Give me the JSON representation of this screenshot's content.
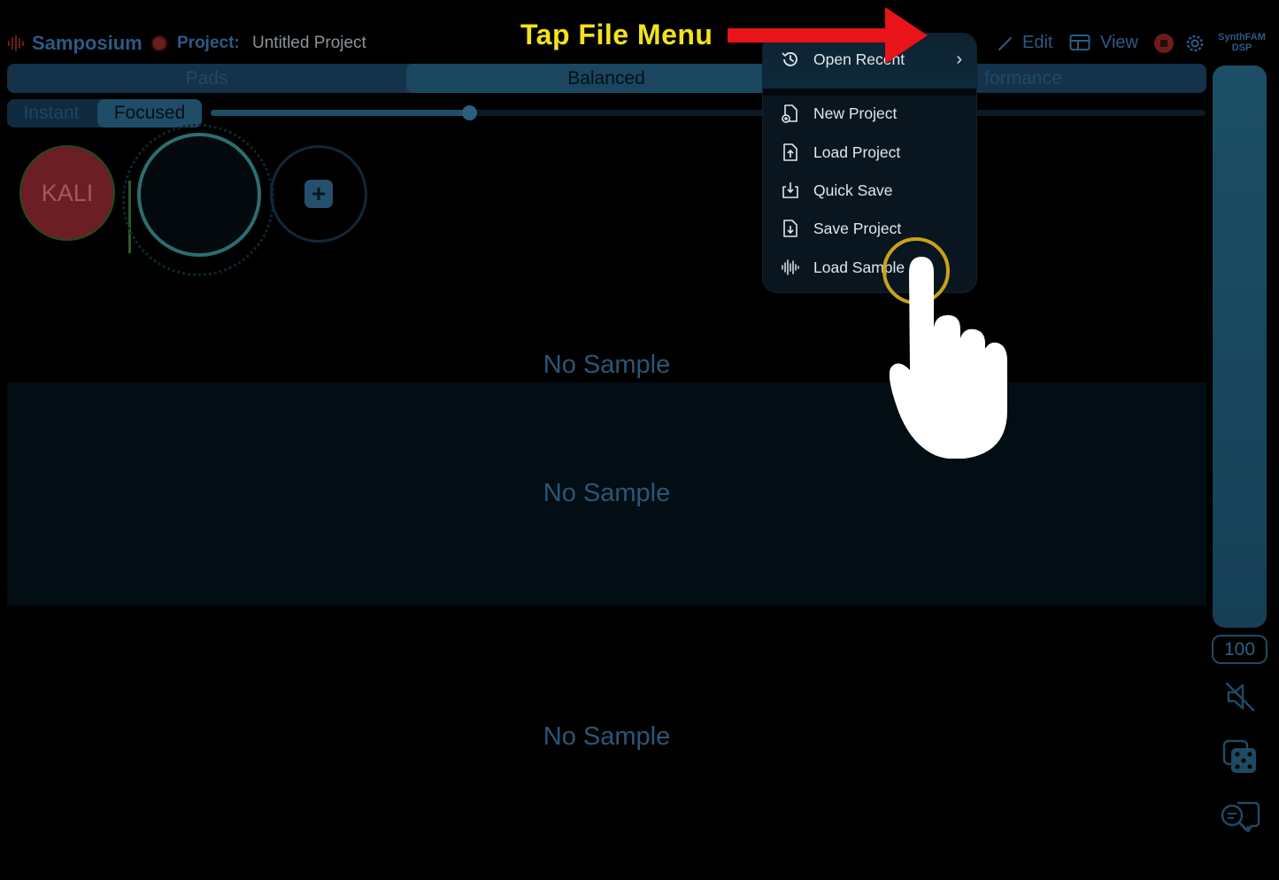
{
  "header": {
    "app_name": "Samposium",
    "project_label": "Project:",
    "project_name": "Untitled Project",
    "edit_label": "Edit",
    "view_label": "View",
    "brand_line1": "SynthFAM",
    "brand_line2": "DSP"
  },
  "mode_tabs": [
    {
      "label": "Pads",
      "active": false
    },
    {
      "label": "Balanced",
      "active": true
    },
    {
      "label": "formance",
      "active": false
    }
  ],
  "sub_tabs": [
    {
      "label": "Instant",
      "active": false
    },
    {
      "label": "Focused",
      "active": true
    }
  ],
  "slider": {
    "value_fraction": 0.26
  },
  "pads": {
    "pad1_label": "KALI"
  },
  "lanes": {
    "lane1_text": "No Sample",
    "lane2_text": "No Sample",
    "lane3_text": "No Sample"
  },
  "volume": {
    "value": "100",
    "fill_fraction": 1.0
  },
  "file_menu": {
    "items": [
      {
        "label": "Open Recent",
        "icon": "clock-history-icon",
        "has_submenu": true
      },
      {
        "label": "New Project",
        "icon": "file-plus-icon"
      },
      {
        "label": "Load Project",
        "icon": "file-upload-icon"
      },
      {
        "label": "Quick Save",
        "icon": "tray-download-icon"
      },
      {
        "label": "Save Project",
        "icon": "file-download-icon"
      },
      {
        "label": "Load Sample",
        "icon": "waveform-icon"
      }
    ]
  },
  "annotation": {
    "title": "Tap File Menu"
  },
  "colors": {
    "accent": "#2d5a85",
    "annotation_yellow": "#f2e21c",
    "annotation_red": "#e8141a",
    "record_red": "#6a1d1d"
  }
}
